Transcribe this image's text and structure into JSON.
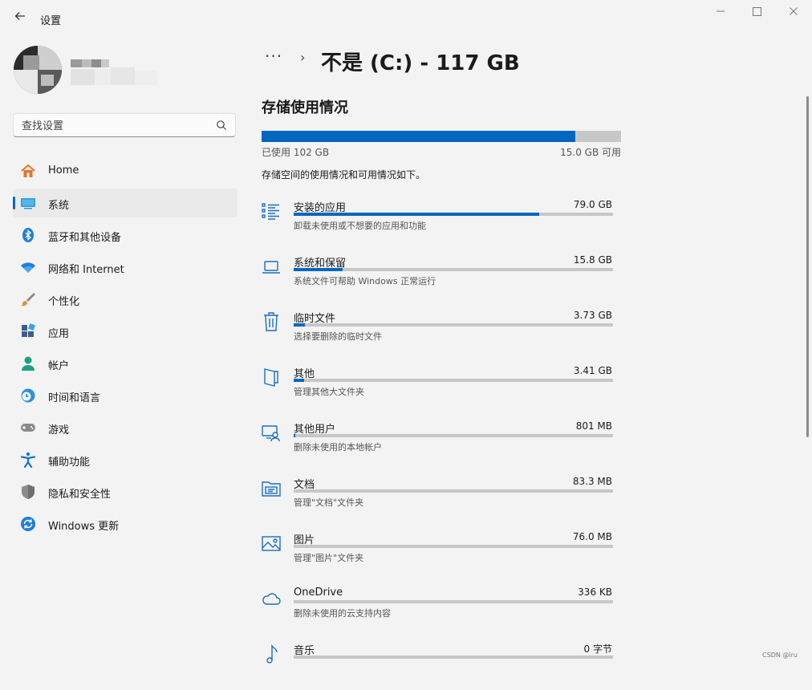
{
  "window": {
    "title": "设置",
    "back_icon": "back-arrow-icon",
    "controls": [
      "minimize",
      "maximize",
      "close"
    ]
  },
  "search": {
    "placeholder": "查找设置"
  },
  "sidebar": {
    "items": [
      {
        "label": "Home",
        "icon": "home-icon"
      },
      {
        "label": "系统",
        "icon": "system-icon",
        "selected": true
      },
      {
        "label": "蓝牙和其他设备",
        "icon": "bluetooth-icon"
      },
      {
        "label": "网络和 Internet",
        "icon": "wifi-icon"
      },
      {
        "label": "个性化",
        "icon": "brush-icon"
      },
      {
        "label": "应用",
        "icon": "apps-icon"
      },
      {
        "label": "帐户",
        "icon": "account-icon"
      },
      {
        "label": "时间和语言",
        "icon": "globe-clock-icon"
      },
      {
        "label": "游戏",
        "icon": "gamepad-icon"
      },
      {
        "label": "辅助功能",
        "icon": "accessibility-icon"
      },
      {
        "label": "隐私和安全性",
        "icon": "shield-icon"
      },
      {
        "label": "Windows 更新",
        "icon": "update-icon"
      }
    ]
  },
  "breadcrumb": {
    "more": "···",
    "chevron": "›",
    "title": "不是 (C:) - 117 GB"
  },
  "storage": {
    "section_title": "存储使用情况",
    "used_label": "已使用 102 GB",
    "free_label": "15.0 GB 可用",
    "used_fraction": 0.872,
    "description": "存储空间的使用情况和可用情况如下。",
    "categories": [
      {
        "name": "安装的应用",
        "size": "79.0 GB",
        "desc": "卸载未使用或不想要的应用和功能",
        "fraction": 0.77,
        "icon": "apps-list-icon"
      },
      {
        "name": "系统和保留",
        "size": "15.8 GB",
        "desc": "系统文件可帮助 Windows 正常运行",
        "fraction": 0.154,
        "icon": "laptop-icon"
      },
      {
        "name": "临时文件",
        "size": "3.73 GB",
        "desc": "选择要删除的临时文件",
        "fraction": 0.036,
        "icon": "trash-icon"
      },
      {
        "name": "其他",
        "size": "3.41 GB",
        "desc": "管理其他大文件夹",
        "fraction": 0.033,
        "icon": "folder-other-icon"
      },
      {
        "name": "其他用户",
        "size": "801 MB",
        "desc": "删除未使用的本地帐户",
        "fraction": 0.008,
        "icon": "other-users-icon"
      },
      {
        "name": "文档",
        "size": "83.3 MB",
        "desc": "管理\"文档\"文件夹",
        "fraction": 0.0,
        "icon": "documents-icon"
      },
      {
        "name": "图片",
        "size": "76.0 MB",
        "desc": "管理\"图片\"文件夹",
        "fraction": 0.0,
        "icon": "pictures-icon"
      },
      {
        "name": "OneDrive",
        "size": "336 KB",
        "desc": "删除未使用的云支持内容",
        "fraction": 0.0,
        "icon": "cloud-icon"
      },
      {
        "name": "音乐",
        "size": "0 字节",
        "desc": "",
        "fraction": 0.0,
        "icon": "music-icon"
      }
    ]
  },
  "watermark": "CSDN @iru",
  "colors": {
    "accent": "#0067c0",
    "bar_bg": "#c7c7c7",
    "window_bg": "#f3f3f3"
  }
}
